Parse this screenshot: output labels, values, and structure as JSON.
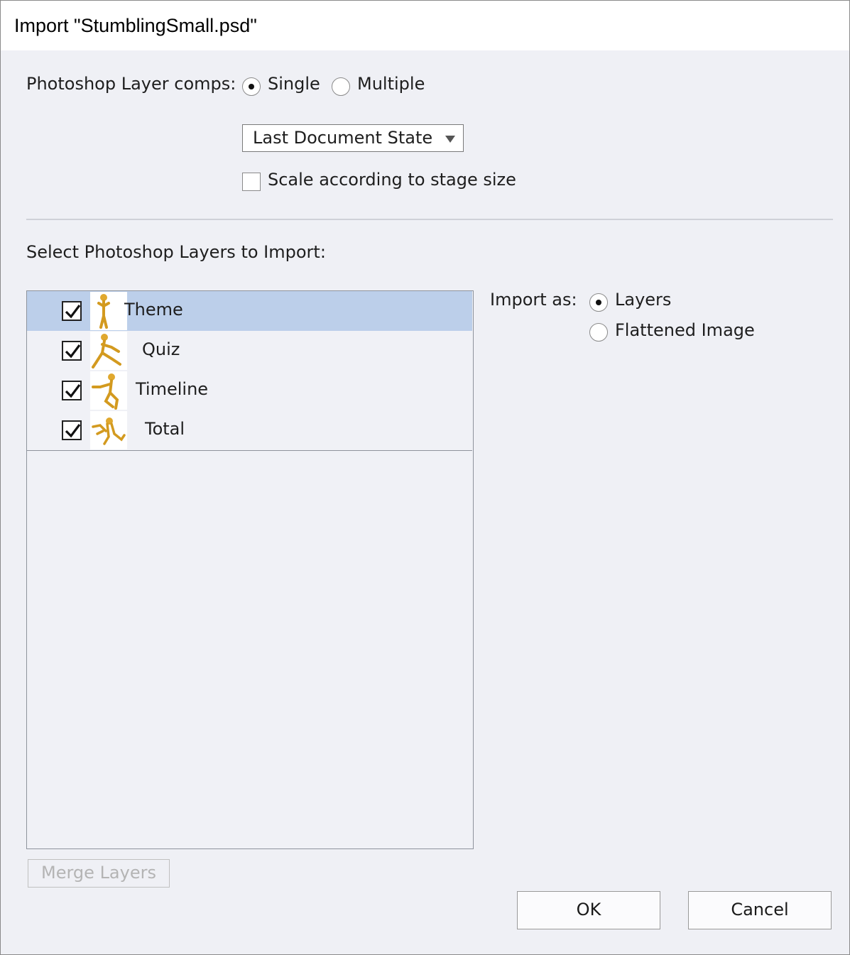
{
  "window": {
    "title": "Import \"StumblingSmall.psd\""
  },
  "layer_comps": {
    "label": "Photoshop Layer comps:",
    "options": [
      {
        "label": "Single",
        "checked": true
      },
      {
        "label": "Multiple",
        "checked": false
      }
    ],
    "dropdown": {
      "value": "Last Document State"
    },
    "scale_checkbox": {
      "label": "Scale according to stage size",
      "checked": false
    }
  },
  "layers_section": {
    "label": "Select Photoshop Layers to Import:",
    "layers": [
      {
        "name": "Theme",
        "checked": true,
        "selected": true,
        "thumbnail": "stick-figure-standing-thumbnail-icon"
      },
      {
        "name": "Quiz",
        "checked": true,
        "selected": false,
        "thumbnail": "stick-figure-running-thumbnail-icon"
      },
      {
        "name": "Timeline",
        "checked": true,
        "selected": false,
        "thumbnail": "stick-figure-stumbling-thumbnail-icon"
      },
      {
        "name": "Total",
        "checked": true,
        "selected": false,
        "thumbnail": "stick-figure-tangled-thumbnail-icon"
      }
    ],
    "merge_button": "Merge Layers"
  },
  "import_as": {
    "label": "Import as:",
    "options": [
      {
        "label": "Layers",
        "checked": true
      },
      {
        "label": "Flattened Image",
        "checked": false
      }
    ]
  },
  "buttons": {
    "ok": "OK",
    "cancel": "Cancel"
  },
  "colors": {
    "selected_row": "#bccfea",
    "dialog_bg": "#eff0f5",
    "figure_gold": "#e0a82e"
  }
}
